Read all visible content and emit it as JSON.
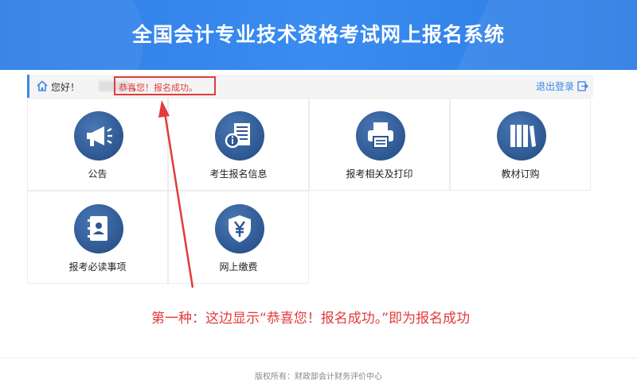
{
  "header": {
    "title": "全国会计专业技术资格考试网上报名系统"
  },
  "topbar": {
    "greeting": "您好！",
    "comma": "，",
    "success_message": "恭喜您！报名成功。",
    "logout_label": "退出登录"
  },
  "tiles": [
    {
      "label": "公告",
      "icon": "megaphone-icon"
    },
    {
      "label": "考生报名信息",
      "icon": "info-document-icon"
    },
    {
      "label": "报考相关及打印",
      "icon": "printer-icon"
    },
    {
      "label": "教材订购",
      "icon": "books-icon"
    },
    {
      "label": "报考必读事项",
      "icon": "contact-book-icon"
    },
    {
      "label": "网上缴费",
      "icon": "yuan-shield-icon"
    }
  ],
  "annotation": {
    "text": "第一种：这边显示“恭喜您！报名成功。”即为报名成功"
  },
  "footer": {
    "copyright": "版权所有：财政部会计财务评价中心"
  },
  "colors": {
    "header_blue": "#3a8cf0",
    "accent_red": "#e23b3b",
    "icon_blue": "#2d5791"
  }
}
